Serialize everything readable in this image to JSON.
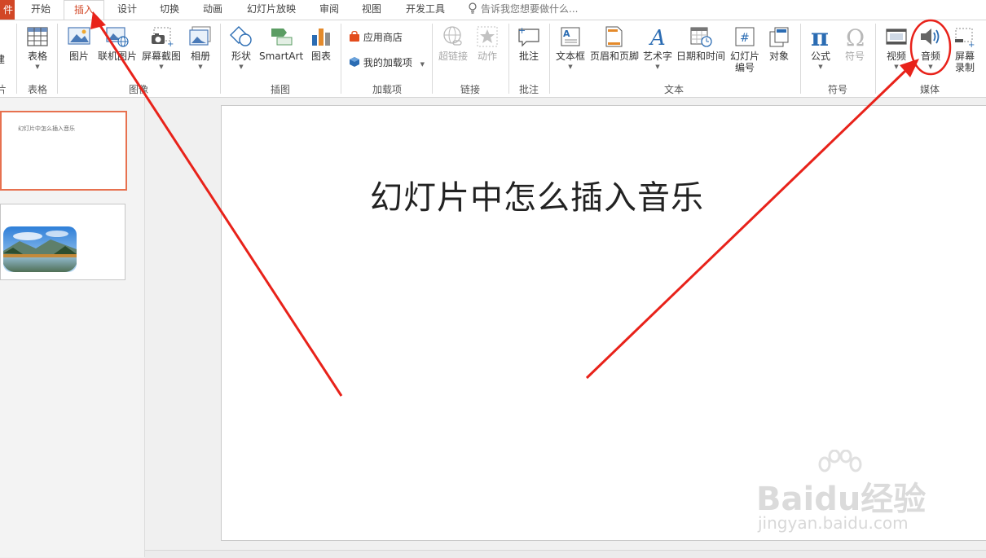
{
  "tabs": {
    "file": "件",
    "items": [
      "开始",
      "插入",
      "设计",
      "切换",
      "动画",
      "幻灯片放映",
      "审阅",
      "视图",
      "开发工具"
    ],
    "active": "插入",
    "tell_me": "告诉我您想要做什么..."
  },
  "ribbon": {
    "groups": {
      "slides_partial": "片",
      "tables": "表格",
      "images": "图像",
      "illustrations": "插图",
      "addins": "加载项",
      "links": "链接",
      "comments": "批注",
      "text": "文本",
      "symbols": "符号",
      "media": "媒体"
    },
    "buttons": {
      "new_slide_partial": "建",
      "table": "表格",
      "picture": "图片",
      "online_picture": "联机图片",
      "screenshot": "屏幕截图",
      "album": "相册",
      "shapes": "形状",
      "smartart": "SmartArt",
      "chart": "图表",
      "store": "应用商店",
      "my_addins": "我的加载项",
      "hyperlink": "超链接",
      "action": "动作",
      "comment": "批注",
      "textbox": "文本框",
      "header_footer": "页眉和页脚",
      "wordart": "艺术字",
      "datetime": "日期和时间",
      "slide_number_line1": "幻灯片",
      "slide_number_line2": "编号",
      "object": "对象",
      "equation": "公式",
      "symbol": "符号",
      "video": "视频",
      "audio": "音频",
      "screen_recording_line1": "屏幕",
      "screen_recording_line2": "录制"
    }
  },
  "thumbnails": {
    "slide1_title": "幻灯片中怎么插入音乐"
  },
  "slide": {
    "title": "幻灯片中怎么插入音乐"
  },
  "watermark": {
    "brand": "Baidu经验",
    "url": "jingyan.baidu.com"
  },
  "colors": {
    "accent": "#d24726",
    "annotation": "#e8221a",
    "icon_blue": "#2b6cb3"
  }
}
